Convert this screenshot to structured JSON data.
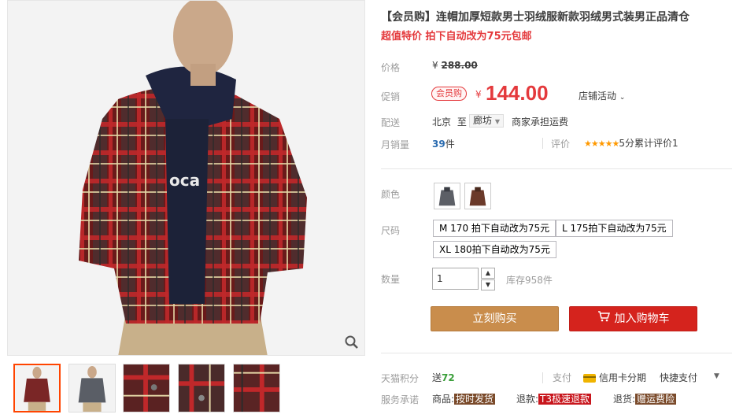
{
  "product": {
    "title": "【会员购】连帽加厚短款男士羽绒服新款羽绒男式装男正品清仓",
    "subtitle": "超值特价 拍下自动改为75元包邮"
  },
  "pricing": {
    "price_label": "价格",
    "currency": "¥",
    "original_price": "288.00",
    "promo_label": "促销",
    "member_badge": "会员购",
    "promo_price": "144.00",
    "store_activity": "店铺活动"
  },
  "shipping": {
    "label": "配送",
    "from": "北京",
    "to_word": "至",
    "destination": "廊坊",
    "fee_note": "商家承担运费"
  },
  "sales": {
    "label": "月销量",
    "count": "39",
    "unit": "件",
    "review_label": "评价",
    "stars": "★★★★★",
    "review_text": "5分累计评价1"
  },
  "options": {
    "color_label": "颜色",
    "size_label": "尺码",
    "sizes": [
      "M 170 拍下自动改为75元",
      "L 175拍下自动改为75元",
      "XL 180拍下自动改为75元"
    ],
    "qty_label": "数量",
    "qty_value": "1",
    "stock": "库存958件"
  },
  "actions": {
    "buy_now": "立刻购买",
    "add_to_cart": "加入购物车"
  },
  "footer": {
    "points_label": "天猫积分",
    "points_prefix": "送",
    "points_value": "72",
    "payment_label": "支付",
    "credit_card": "信用卡分期",
    "quick_pay": "快捷支付",
    "service_label": "服务承诺",
    "goods_label": "商品:",
    "goods_tag": "按时发货",
    "return_label": "退款:",
    "return_tag": "T3极速退款",
    "refund_label": "退货:",
    "refund_tag": "赠运费险"
  },
  "colors": {
    "accent_red": "#e4393c",
    "buy_button": "#c98d4c",
    "cart_button": "#d5231d"
  }
}
